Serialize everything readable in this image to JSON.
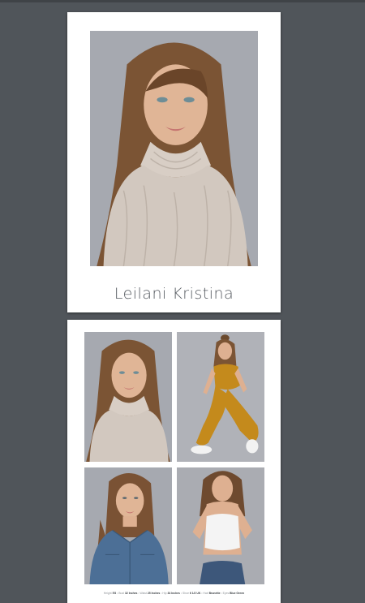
{
  "model": {
    "name": "Leilani Kristina"
  },
  "photos": [
    {
      "id": "hero",
      "subject": "headshot in knitted turtleneck sweater"
    },
    {
      "id": "a",
      "subject": "headshot in knitted turtleneck sweater"
    },
    {
      "id": "b",
      "subject": "full body crouching in mustard jumpsuit"
    },
    {
      "id": "c",
      "subject": "portrait in denim jacket"
    },
    {
      "id": "d",
      "subject": "white tank top and jeans"
    }
  ],
  "stats": [
    {
      "label": "Height",
      "value": "5'8"
    },
    {
      "label": "Bust",
      "value": "32 Inches"
    },
    {
      "label": "Waist",
      "value": "25 Inches"
    },
    {
      "label": "Hip",
      "value": "34 Inches"
    },
    {
      "label": "Shoe",
      "value": "6 1/2 UK"
    },
    {
      "label": "Hair",
      "value": "Brunette"
    },
    {
      "label": "Eyes",
      "value": "Blue Green"
    }
  ],
  "colors": {
    "viewer_bg": "#50555a",
    "photo_bg": "#a9abb1",
    "hair": "#7a5234",
    "sweater": "#d2c8bf",
    "jumpsuit": "#c48a1c",
    "denim": "#4c6f96"
  }
}
